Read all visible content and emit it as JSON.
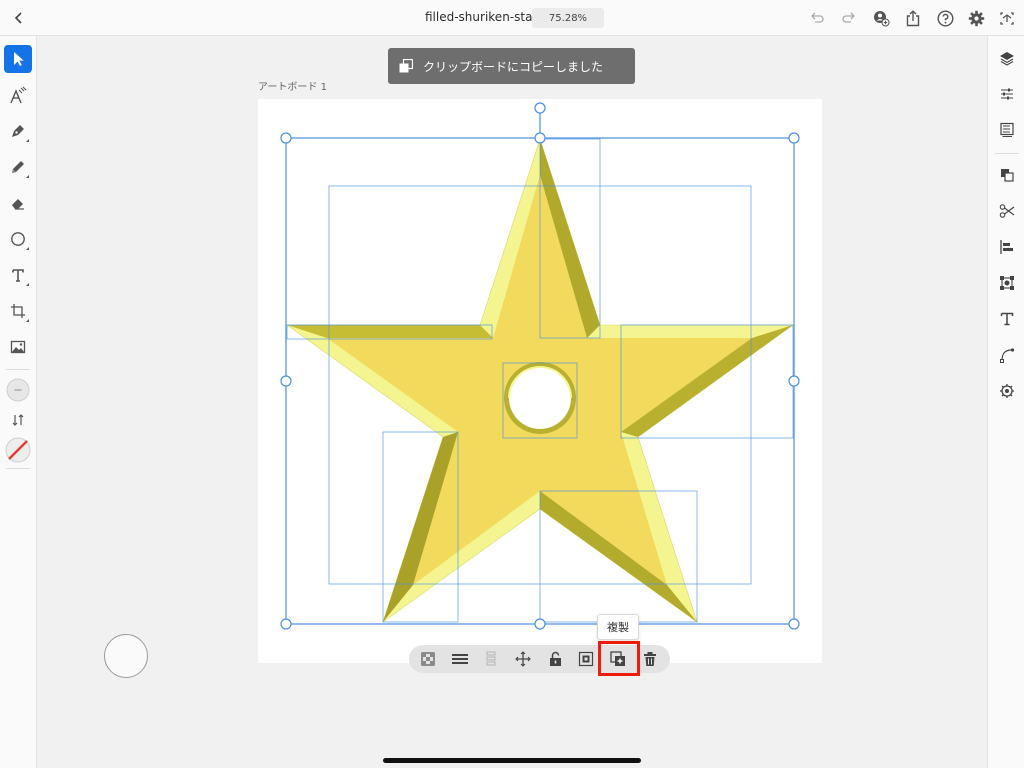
{
  "header": {
    "back_icon": "chevron-left-icon",
    "document_title": "filled-shuriken-star",
    "zoom_level": "75.28%",
    "icons": [
      "undo-icon",
      "redo-icon",
      "add-user-icon",
      "share-icon",
      "help-icon",
      "settings-icon",
      "preview-icon"
    ]
  },
  "left_tools": [
    "selection-tool",
    "touch-type-tool",
    "pen-tool",
    "pencil-tool",
    "eraser-tool",
    "shape-tool",
    "type-tool",
    "crop-tool",
    "image-tool"
  ],
  "fill_stroke": {
    "fill": "none",
    "stroke": "none",
    "accent": "#1473e6",
    "slash_color": "#e03b30"
  },
  "right_tools": [
    "layers-panel",
    "properties-panel",
    "libraries-panel",
    "arrange-panel",
    "pathfinder-panel",
    "align-panel",
    "transform-panel",
    "type-panel",
    "path-panel",
    "plugins-panel"
  ],
  "canvas": {
    "artboard_label": "アートボード 1",
    "star_colors": {
      "face": "#f2db5c",
      "light_bevel": "#f4f590",
      "dark_bevel": "#b1a92b",
      "selection": "#4a90e2"
    }
  },
  "toast": {
    "icon": "copy-icon",
    "message": "クリップボードにコピーしました"
  },
  "context_menu": {
    "tooltip": "複製",
    "highlight_color": "#ee1c0b",
    "buttons": [
      {
        "name": "fill-button",
        "icon": "checker-icon"
      },
      {
        "name": "stroke-button",
        "icon": "lines-icon"
      },
      {
        "name": "pattern-button",
        "icon": "stack-icon"
      },
      {
        "name": "move-button",
        "icon": "move-icon"
      },
      {
        "name": "lock-button",
        "icon": "lock-icon"
      },
      {
        "name": "group-button",
        "icon": "group-icon"
      },
      {
        "name": "duplicate-button",
        "icon": "duplicate-icon"
      },
      {
        "name": "delete-button",
        "icon": "trash-icon"
      }
    ]
  }
}
